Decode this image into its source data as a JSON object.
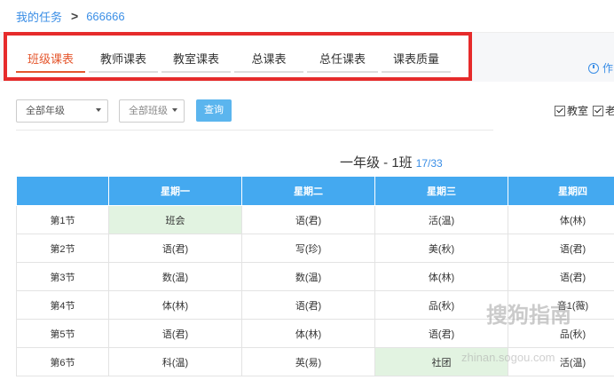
{
  "breadcrumb": {
    "root": "我的任务",
    "current": "666666"
  },
  "tabs": [
    {
      "label": "班级课表",
      "active": true
    },
    {
      "label": "教师课表",
      "active": false
    },
    {
      "label": "教室课表",
      "active": false
    },
    {
      "label": "总课表",
      "active": false
    },
    {
      "label": "总任课表",
      "active": false
    },
    {
      "label": "课表质量",
      "active": false
    }
  ],
  "help_text": "作",
  "filters": {
    "grade_selected": "全部年级",
    "class_selected": "全部班级",
    "query_label": "查询"
  },
  "options": [
    {
      "label": "教室",
      "checked": true
    },
    {
      "label": "老",
      "checked": true
    }
  ],
  "timetable": {
    "title": "一年级 - 1班",
    "count": "17/33",
    "headers": [
      "",
      "星期一",
      "星期二",
      "星期三",
      "星期四"
    ],
    "rows": [
      {
        "period": "第1节",
        "cells": [
          "班会",
          "语(君)",
          "活(温)",
          "体(林)"
        ]
      },
      {
        "period": "第2节",
        "cells": [
          "语(君)",
          "写(珍)",
          "美(秋)",
          "语(君)"
        ]
      },
      {
        "period": "第3节",
        "cells": [
          "数(温)",
          "数(温)",
          "体(林)",
          "语(君)"
        ]
      },
      {
        "period": "第4节",
        "cells": [
          "体(林)",
          "语(君)",
          "品(秋)",
          "音1(薇)"
        ]
      },
      {
        "period": "第5节",
        "cells": [
          "语(君)",
          "体(林)",
          "语(君)",
          "品(秋)"
        ]
      },
      {
        "period": "第6节",
        "cells": [
          "科(温)",
          "英(易)",
          "社团",
          "活(温)"
        ]
      }
    ]
  },
  "watermark": {
    "main": "搜狗指南",
    "sub": "zhinan.sogou.com"
  }
}
